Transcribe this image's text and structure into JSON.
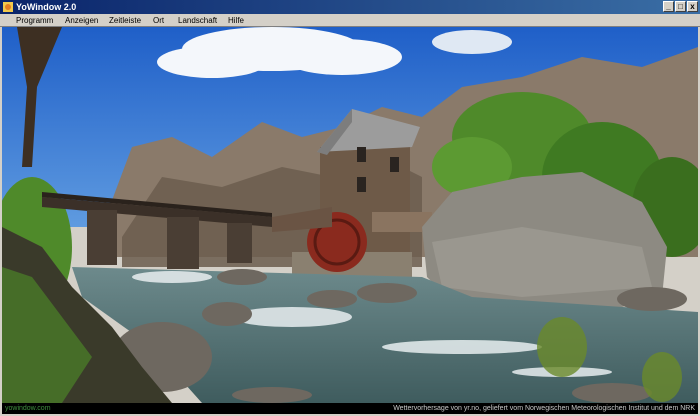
{
  "window": {
    "title": "YoWindow 2.0",
    "controls": {
      "minimize": "_",
      "maximize": "□",
      "close": "x"
    }
  },
  "menu": {
    "items": [
      {
        "label": "Programm"
      },
      {
        "label": "Anzeigen"
      },
      {
        "label": "Zeitleiste"
      },
      {
        "label": "Ort"
      },
      {
        "label": "Landschaft"
      },
      {
        "label": "Hilfe"
      }
    ]
  },
  "status": {
    "site": "yowindow.com",
    "credit": "Wettervorhersage von yr.no, geliefert vom Norwegischen Meteorologischen Institut und dem NRK"
  },
  "colors": {
    "titlebar_start": "#0a246a",
    "titlebar_end": "#3a6ea5",
    "sky": "#2f6fd2",
    "water": "#4a6a6e"
  }
}
